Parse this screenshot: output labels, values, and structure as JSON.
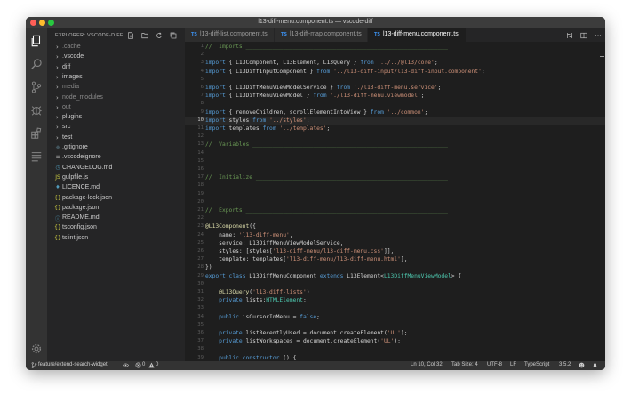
{
  "window": {
    "title": "l13-diff-menu.component.ts — vscode-diff"
  },
  "activity_bar": {
    "items": [
      {
        "name": "explorer-icon"
      },
      {
        "name": "search-icon"
      },
      {
        "name": "source-control-icon"
      },
      {
        "name": "debug-icon"
      },
      {
        "name": "extensions-icon"
      },
      {
        "name": "outline-icon"
      }
    ],
    "bottom": {
      "name": "gear-icon"
    }
  },
  "sidebar": {
    "title": "EXPLORER: VSCODE-DIFF",
    "items": [
      {
        "label": ".cache",
        "type": "folder",
        "dim": true
      },
      {
        "label": ".vscode",
        "type": "folder",
        "dim": false
      },
      {
        "label": "diff",
        "type": "folder",
        "dim": false
      },
      {
        "label": "images",
        "type": "folder",
        "dim": false
      },
      {
        "label": "media",
        "type": "folder",
        "dim": true
      },
      {
        "label": "node_modules",
        "type": "folder",
        "dim": true
      },
      {
        "label": "out",
        "type": "folder",
        "dim": true
      },
      {
        "label": "plugins",
        "type": "folder",
        "dim": false
      },
      {
        "label": "src",
        "type": "folder",
        "dim": false
      },
      {
        "label": "test",
        "type": "folder",
        "dim": false
      },
      {
        "label": ".gitignore",
        "type": "file",
        "icon": "◆",
        "color": "#41535b",
        "dim": false
      },
      {
        "label": ".vscodeignore",
        "type": "file",
        "icon": "≡",
        "color": "#cccccc",
        "dim": false
      },
      {
        "label": "CHANGELOG.md",
        "type": "file",
        "icon": "◷",
        "color": "#519aba",
        "dim": false
      },
      {
        "label": "gulpfile.js",
        "type": "file",
        "icon": "JS",
        "color": "#cbcb41",
        "dim": false
      },
      {
        "label": "LICENCE.md",
        "type": "file",
        "icon": "♦",
        "color": "#519aba",
        "dim": false
      },
      {
        "label": "package-lock.json",
        "type": "file",
        "icon": "{}",
        "color": "#cbcb41",
        "dim": false
      },
      {
        "label": "package.json",
        "type": "file",
        "icon": "{}",
        "color": "#cbcb41",
        "dim": false
      },
      {
        "label": "README.md",
        "type": "file",
        "icon": "ⓘ",
        "color": "#519aba",
        "dim": false
      },
      {
        "label": "tsconfig.json",
        "type": "file",
        "icon": "{}",
        "color": "#cbcb41",
        "dim": false
      },
      {
        "label": "tslint.json",
        "type": "file",
        "icon": "{}",
        "color": "#cbcb41",
        "dim": false
      }
    ]
  },
  "tabs": [
    {
      "label": "l13-diff-list.component.ts",
      "badge": "TS",
      "active": false
    },
    {
      "label": "l13-diff-map.component.ts",
      "badge": "TS",
      "active": false
    },
    {
      "label": "l13-diff-menu.component.ts",
      "badge": "TS",
      "active": true
    }
  ],
  "editor": {
    "current_line": 10,
    "lines": [
      {
        "n": "1",
        "parts": [
          [
            "cm",
            "//  Imports ____________________________________________________________"
          ]
        ]
      },
      {
        "n": "2",
        "parts": []
      },
      {
        "n": "3",
        "parts": [
          [
            "kw",
            "import"
          ],
          [
            "plain",
            " { L13Component, L13Element, L13Query } "
          ],
          [
            "kw",
            "from"
          ],
          [
            "plain",
            " "
          ],
          [
            "str",
            "'../../@l13/core'"
          ],
          [
            "plain",
            ";"
          ]
        ]
      },
      {
        "n": "4",
        "parts": [
          [
            "kw",
            "import"
          ],
          [
            "plain",
            " { L13DiffInputComponent } "
          ],
          [
            "kw",
            "from"
          ],
          [
            "plain",
            " "
          ],
          [
            "str",
            "'../l13-diff-input/l13-diff-input.component'"
          ],
          [
            "plain",
            ";"
          ]
        ]
      },
      {
        "n": "5",
        "parts": []
      },
      {
        "n": "6",
        "parts": [
          [
            "kw",
            "import"
          ],
          [
            "plain",
            " { L13DiffMenuViewModelService } "
          ],
          [
            "kw",
            "from"
          ],
          [
            "plain",
            " "
          ],
          [
            "str",
            "'./l13-diff-menu.service'"
          ],
          [
            "plain",
            ";"
          ]
        ]
      },
      {
        "n": "7",
        "parts": [
          [
            "kw",
            "import"
          ],
          [
            "plain",
            " { L13DiffMenuViewModel } "
          ],
          [
            "kw",
            "from"
          ],
          [
            "plain",
            " "
          ],
          [
            "str",
            "'./l13-diff-menu.viewmodel'"
          ],
          [
            "plain",
            ";"
          ]
        ]
      },
      {
        "n": "8",
        "parts": []
      },
      {
        "n": "9",
        "parts": [
          [
            "kw",
            "import"
          ],
          [
            "plain",
            " { removeChildren, scrollElementIntoView } "
          ],
          [
            "kw",
            "from"
          ],
          [
            "plain",
            " "
          ],
          [
            "str",
            "'../common'"
          ],
          [
            "plain",
            ";"
          ]
        ]
      },
      {
        "n": "10",
        "parts": [
          [
            "kw",
            "import"
          ],
          [
            "plain",
            " styles "
          ],
          [
            "kw",
            "from"
          ],
          [
            "plain",
            " "
          ],
          [
            "str",
            "'../styles'"
          ],
          [
            "plain",
            ";"
          ]
        ]
      },
      {
        "n": "11",
        "parts": [
          [
            "kw",
            "import"
          ],
          [
            "plain",
            " templates "
          ],
          [
            "kw",
            "from"
          ],
          [
            "plain",
            " "
          ],
          [
            "str",
            "'../templates'"
          ],
          [
            "plain",
            ";"
          ]
        ]
      },
      {
        "n": "12",
        "parts": []
      },
      {
        "n": "13",
        "parts": [
          [
            "cm",
            "//  Variables __________________________________________________________"
          ]
        ]
      },
      {
        "n": "14",
        "parts": []
      },
      {
        "n": "15",
        "parts": []
      },
      {
        "n": "16",
        "parts": []
      },
      {
        "n": "17",
        "parts": [
          [
            "cm",
            "//  Initialize _________________________________________________________"
          ]
        ]
      },
      {
        "n": "18",
        "parts": []
      },
      {
        "n": "19",
        "parts": []
      },
      {
        "n": "20",
        "parts": []
      },
      {
        "n": "21",
        "parts": [
          [
            "cm",
            "//  Exports ____________________________________________________________"
          ]
        ]
      },
      {
        "n": "22",
        "parts": []
      },
      {
        "n": "23",
        "parts": [
          [
            "dec",
            "@L13Component"
          ],
          [
            "plain",
            "({"
          ]
        ]
      },
      {
        "n": "24",
        "parts": [
          [
            "plain",
            "    name: "
          ],
          [
            "str",
            "'l13-diff-menu'"
          ],
          [
            "plain",
            ","
          ]
        ]
      },
      {
        "n": "25",
        "parts": [
          [
            "plain",
            "    service: L13DiffMenuViewModelService,"
          ]
        ]
      },
      {
        "n": "26",
        "parts": [
          [
            "plain",
            "    styles: [styles["
          ],
          [
            "str",
            "'l13-diff-menu/l13-diff-menu.css'"
          ],
          [
            "plain",
            "]],"
          ]
        ]
      },
      {
        "n": "27",
        "parts": [
          [
            "plain",
            "    template: templates["
          ],
          [
            "str",
            "'l13-diff-menu/l13-diff-menu.html'"
          ],
          [
            "plain",
            "],"
          ]
        ]
      },
      {
        "n": "28",
        "parts": [
          [
            "plain",
            "})"
          ]
        ]
      },
      {
        "n": "29",
        "parts": [
          [
            "kw",
            "export class"
          ],
          [
            "plain",
            " L13DiffMenuComponent "
          ],
          [
            "kw",
            "extends"
          ],
          [
            "plain",
            " L13Element<"
          ],
          [
            "type",
            "L13DiffMenuViewModel"
          ],
          [
            "plain",
            "> {"
          ]
        ]
      },
      {
        "n": "30",
        "parts": []
      },
      {
        "n": "31",
        "parts": [
          [
            "plain",
            "    "
          ],
          [
            "dec",
            "@L13Query"
          ],
          [
            "plain",
            "("
          ],
          [
            "str",
            "'l13-diff-lists'"
          ],
          [
            "plain",
            ")"
          ]
        ]
      },
      {
        "n": "32",
        "parts": [
          [
            "plain",
            "    "
          ],
          [
            "kw",
            "private"
          ],
          [
            "plain",
            " lists:"
          ],
          [
            "type",
            "HTMLElement"
          ],
          [
            "plain",
            ";"
          ]
        ]
      },
      {
        "n": "33",
        "parts": []
      },
      {
        "n": "34",
        "parts": [
          [
            "plain",
            "    "
          ],
          [
            "kw",
            "public"
          ],
          [
            "plain",
            " isCursorInMenu = "
          ],
          [
            "kw",
            "false"
          ],
          [
            "plain",
            ";"
          ]
        ]
      },
      {
        "n": "35",
        "parts": []
      },
      {
        "n": "36",
        "parts": [
          [
            "plain",
            "    "
          ],
          [
            "kw",
            "private"
          ],
          [
            "plain",
            " listRecentlyUsed = document.createElement("
          ],
          [
            "str",
            "'UL'"
          ],
          [
            "plain",
            ");"
          ]
        ]
      },
      {
        "n": "37",
        "parts": [
          [
            "plain",
            "    "
          ],
          [
            "kw",
            "private"
          ],
          [
            "plain",
            " listWorkspaces = document.createElement("
          ],
          [
            "str",
            "'UL'"
          ],
          [
            "plain",
            ");"
          ]
        ]
      },
      {
        "n": "38",
        "parts": []
      },
      {
        "n": "39",
        "parts": [
          [
            "plain",
            "    "
          ],
          [
            "kw",
            "public"
          ],
          [
            "plain",
            " "
          ],
          [
            "kw",
            "constructor"
          ],
          [
            "plain",
            " () {"
          ]
        ]
      }
    ]
  },
  "status_bar": {
    "branch": "feature/extend-search-widget",
    "errors": "0",
    "warnings": "0",
    "position": "Ln 10, Col 32",
    "tab_size": "Tab Size: 4",
    "encoding": "UTF-8",
    "eol": "LF",
    "language": "TypeScript",
    "version": "3.5.2"
  }
}
